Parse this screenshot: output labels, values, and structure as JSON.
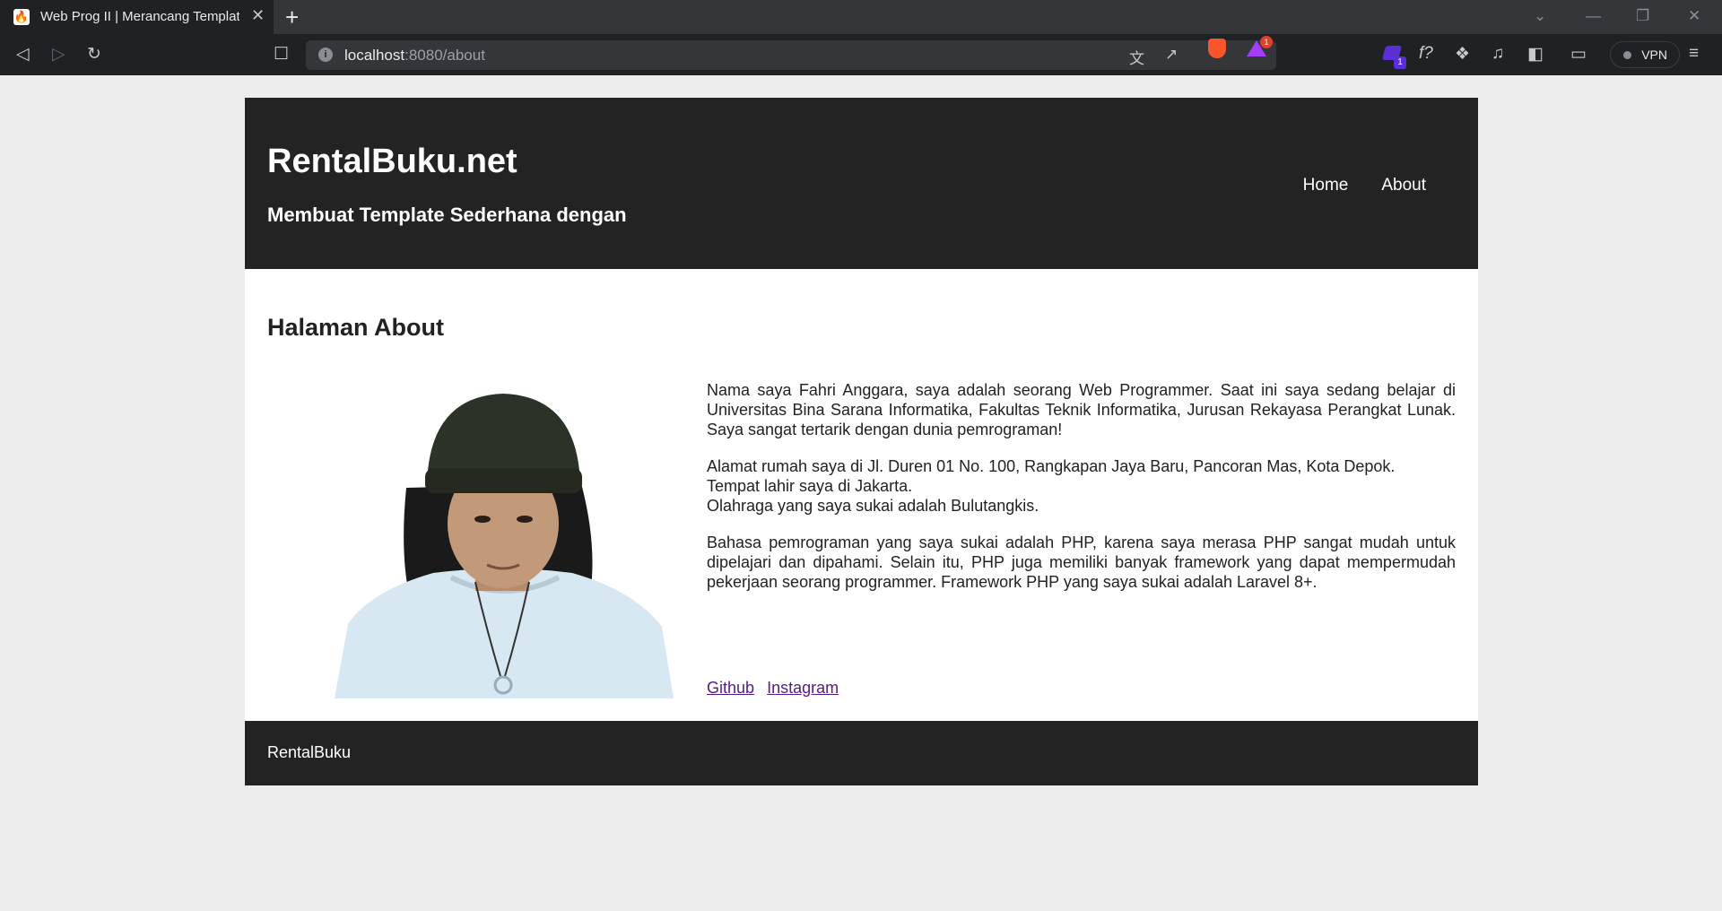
{
  "browser": {
    "tab_title": "Web Prog II | Merancang Templat",
    "url_host": "localhost",
    "url_path": ":8080/about",
    "vpn_label": "VPN",
    "rewards_badge": "1",
    "leo_badge": "1"
  },
  "site": {
    "title": "RentalBuku.net",
    "subtitle": "Membuat Template Sederhana dengan",
    "nav": {
      "home": "Home",
      "about": "About"
    }
  },
  "page": {
    "heading": "Halaman About",
    "paragraph1": "Nama saya Fahri Anggara, saya adalah seorang Web Programmer. Saat ini saya sedang belajar di Universitas Bina Sarana Informatika, Fakultas Teknik Informatika, Jurusan Rekayasa Perangkat Lunak. Saya sangat tertarik dengan dunia pemrograman!",
    "address_line": "Alamat rumah saya di Jl. Duren 01 No. 100, Rangkapan Jaya Baru, Pancoran Mas, Kota Depok.",
    "birthplace_line": "Tempat lahir saya di Jakarta.",
    "sport_line": "Olahraga yang saya sukai adalah Bulutangkis.",
    "paragraph3": "Bahasa pemrograman yang saya sukai adalah PHP, karena saya merasa PHP sangat mudah untuk dipelajari dan dipahami. Selain itu, PHP juga memiliki banyak framework yang dapat mempermudah pekerjaan seorang programmer. Framework PHP yang saya sukai adalah Laravel 8+.",
    "links": {
      "github": "Github",
      "instagram": "Instagram"
    }
  },
  "footer": {
    "text": "RentalBuku"
  },
  "colors": {
    "header_bg": "#232323",
    "page_bg": "#ededed",
    "link": "#551a8b"
  }
}
